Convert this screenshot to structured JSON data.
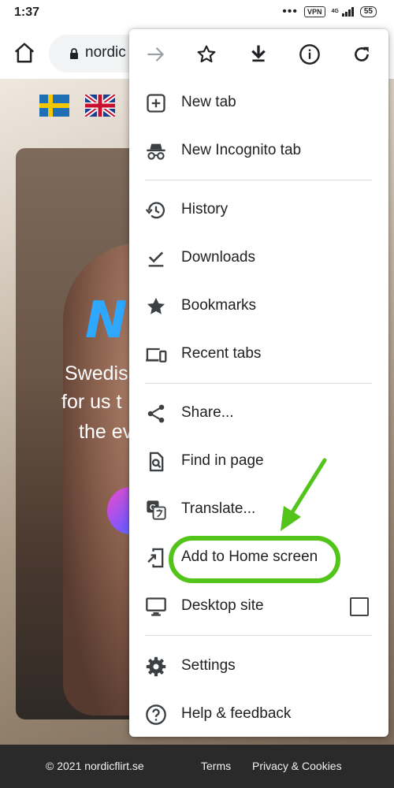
{
  "status_bar": {
    "time": "1:37",
    "vpn": "VPN",
    "network": "4G",
    "battery": "55"
  },
  "toolbar": {
    "url": "nordic",
    "home_icon": "home-icon",
    "lock_icon": "lock-icon"
  },
  "page": {
    "hero_logo": "N",
    "hero_line1": "Swedis",
    "hero_line2": "for us t",
    "hero_line3": "the ev",
    "flags": [
      "sweden-flag-icon",
      "uk-flag-icon"
    ]
  },
  "footer": {
    "copyright": "© 2021 nordicflirt.se",
    "terms": "Terms",
    "privacy": "Privacy & Cookies"
  },
  "menu": {
    "top_buttons": [
      {
        "name": "forward-icon",
        "enabled": false
      },
      {
        "name": "bookmark-star-icon",
        "enabled": true
      },
      {
        "name": "download-icon",
        "enabled": true
      },
      {
        "name": "page-info-icon",
        "enabled": true
      },
      {
        "name": "refresh-icon",
        "enabled": true
      }
    ],
    "items": {
      "new_tab": "New tab",
      "new_incognito_tab": "New Incognito tab",
      "history": "History",
      "downloads": "Downloads",
      "bookmarks": "Bookmarks",
      "recent_tabs": "Recent tabs",
      "share": "Share...",
      "find_in_page": "Find in page",
      "translate": "Translate...",
      "add_to_home_screen": "Add to Home screen",
      "desktop_site": "Desktop site",
      "settings": "Settings",
      "help_feedback": "Help & feedback"
    },
    "desktop_site_checked": false
  },
  "colors": {
    "highlight": "#52c41a",
    "menu_icon": "#3c4043",
    "footer_bg": "#2a2a2a"
  }
}
